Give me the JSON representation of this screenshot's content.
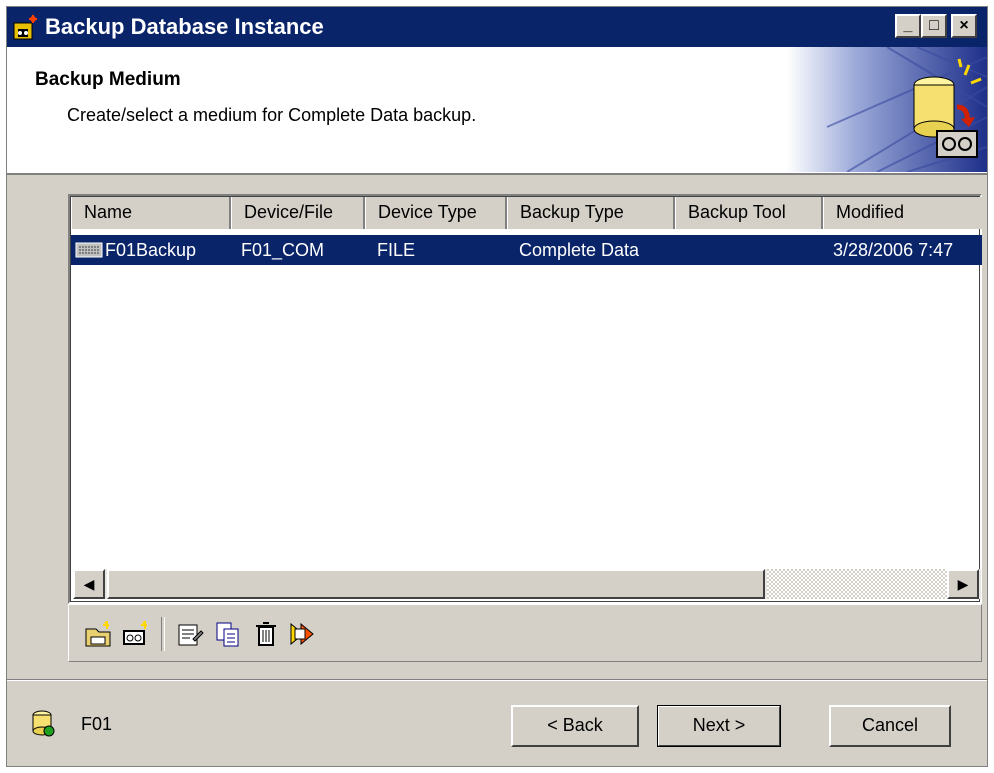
{
  "window": {
    "title": "Backup Database Instance",
    "controls": [
      "_",
      "□",
      "×"
    ]
  },
  "header": {
    "title": "Backup Medium",
    "subtitle": "Create/select a medium for Complete Data backup."
  },
  "list": {
    "columns": [
      "Name",
      "Device/File",
      "Device Type",
      "Backup Type",
      "Backup Tool",
      "Modified"
    ],
    "rows": [
      {
        "name": "F01Backup",
        "device_file": "F01_COM",
        "device_type": "FILE",
        "backup_type": "Complete Data",
        "backup_tool": "",
        "modified": "3/28/2006 7:47"
      }
    ]
  },
  "toolbar": {
    "icons": [
      "new-file-medium-icon",
      "new-tape-medium-icon",
      "properties-icon",
      "copy-icon",
      "delete-icon",
      "migrate-icon"
    ]
  },
  "status": {
    "instance": "F01"
  },
  "buttons": {
    "back": "< Back",
    "next": "Next >",
    "cancel": "Cancel"
  },
  "colors": {
    "titlebar": "#0a246a",
    "selection": "#0a246a",
    "face": "#d4d0c8"
  }
}
